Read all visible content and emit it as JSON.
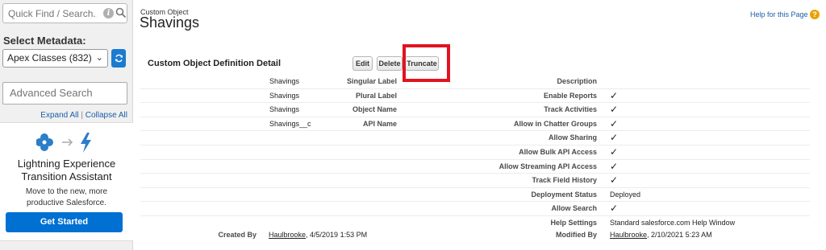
{
  "sidebar": {
    "quick_find_placeholder": "Quick Find / Search...",
    "select_metadata_label": "Select Metadata:",
    "metadata_selected": "Apex Classes (832)",
    "advanced_search_placeholder": "Advanced Search",
    "expand_all": "Expand All",
    "separator": "|",
    "collapse_all": "Collapse All",
    "lightning": {
      "title_line1": "Lightning Experience",
      "title_line2": "Transition Assistant",
      "desc_line1": "Move to the new, more",
      "desc_line2": "productive Salesforce.",
      "button": "Get Started"
    }
  },
  "header": {
    "object_type": "Custom Object",
    "object_name": "Shavings",
    "help_link": "Help for this Page",
    "help_icon": "?"
  },
  "detail": {
    "section_title": "Custom Object Definition Detail",
    "buttons": {
      "edit": "Edit",
      "delete": "Delete",
      "truncate": "Truncate"
    },
    "left_rows": [
      {
        "label": "Singular Label",
        "value": "Shavings"
      },
      {
        "label": "Plural Label",
        "value": "Shavings"
      },
      {
        "label": "Object Name",
        "value": "Shavings"
      },
      {
        "label": "API Name",
        "value": "Shavings__c"
      }
    ],
    "right_rows": [
      {
        "label": "Description",
        "value": ""
      },
      {
        "label": "Enable Reports",
        "value": "✓"
      },
      {
        "label": "Track Activities",
        "value": "✓"
      },
      {
        "label": "Allow in Chatter Groups",
        "value": "✓"
      },
      {
        "label": "Allow Sharing",
        "value": "✓"
      },
      {
        "label": "Allow Bulk API Access",
        "value": "✓"
      },
      {
        "label": "Allow Streaming API Access",
        "value": "✓"
      },
      {
        "label": "Track Field History",
        "value": "✓"
      },
      {
        "label": "Deployment Status",
        "value": "Deployed"
      },
      {
        "label": "Allow Search",
        "value": "✓"
      },
      {
        "label": "Help Settings",
        "value": "Standard salesforce.com Help Window"
      }
    ],
    "created_by_label": "Created By",
    "created_by_user": "Haulbrooke",
    "created_by_date": ", 4/5/2019 1:53 PM",
    "modified_by_label": "Modified By",
    "modified_by_user": "Haulbrooke",
    "modified_by_date": ", 2/10/2021 5:23 AM"
  },
  "colors": {
    "accent": "#0070d2",
    "highlight": "#e0141f",
    "link": "#1a5ea8"
  },
  "icons": [
    "search-icon",
    "info-icon",
    "refresh-icon",
    "chevron-down-icon",
    "flower-icon",
    "arrow-right-icon",
    "lightning-bolt-icon",
    "help-icon",
    "checkmark-icon"
  ]
}
